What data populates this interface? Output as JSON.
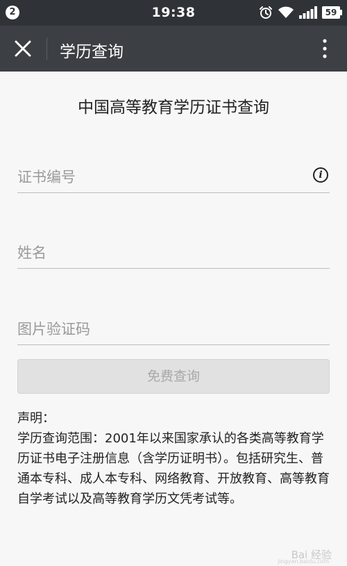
{
  "status_bar": {
    "notification_count": "2",
    "time": "19:38",
    "battery": "59",
    "icons": [
      "alarm-icon",
      "wifi-icon",
      "signal-icon",
      "battery-icon"
    ]
  },
  "app_bar": {
    "title": "学历查询",
    "icons": [
      "close-icon",
      "more-vert-icon"
    ]
  },
  "page": {
    "title": "中国高等教育学历证书查询"
  },
  "form": {
    "certificate_placeholder": "证书编号",
    "name_placeholder": "姓名",
    "captcha_placeholder": "图片验证码",
    "submit_label": "免费查询"
  },
  "disclaimer": {
    "heading": "声明：",
    "body": "学历查询范围：2001年以来国家承认的各类高等教育学历证书电子注册信息（含学历证明书）。包括研究生、普通本专科、成人本专科、网络教育、开放教育、高等教育自学考试以及高等教育学历文凭考试等。"
  },
  "watermark": {
    "text": "Bai 经验",
    "sub": "jingyan.baidu.com"
  },
  "colors": {
    "status_bar": "#2f3236",
    "app_bar": "#3c3f43",
    "background": "#f7f7f7",
    "button_disabled": "#e1e1e1"
  }
}
